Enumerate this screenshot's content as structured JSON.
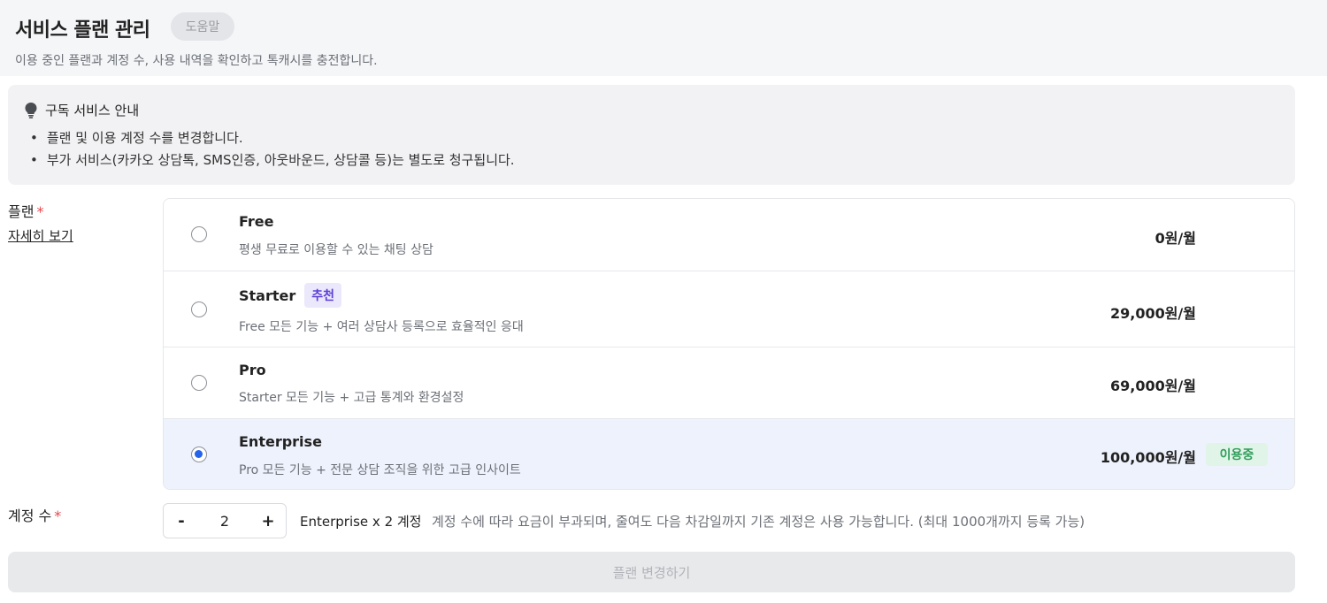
{
  "header": {
    "title": "서비스 플랜 관리",
    "help_label": "도움말",
    "subtitle": "이용 중인 플랜과 계정 수, 사용 내역을 확인하고 톡캐시를 충전합니다."
  },
  "notice": {
    "icon": "lightbulb-icon",
    "title": "구독 서비스 안내",
    "items": [
      "플랜 및 이용 계정 수를 변경합니다.",
      "부가 서비스(카카오 상담톡, SMS인증, 아웃바운드, 상담콜 등)는 별도로 청구됩니다."
    ]
  },
  "plan_section": {
    "label": "플랜",
    "required_mark": "*",
    "detail_link": "자세히 보기",
    "plans": [
      {
        "name": "Free",
        "desc": "평생 무료로 이용할 수 있는 채팅 상담",
        "price": "0원/월",
        "selected": false
      },
      {
        "name": "Starter",
        "badge": "추천",
        "desc": "Free 모든 기능 + 여러 상담사 등록으로 효율적인 응대",
        "price": "29,000원/월",
        "selected": false
      },
      {
        "name": "Pro",
        "desc": "Starter 모든 기능 + 고급 통계와 환경설정",
        "price": "69,000원/월",
        "selected": false
      },
      {
        "name": "Enterprise",
        "desc": "Pro 모든 기능 + 전문 상담 조직을 위한 고급 인사이트",
        "price": "100,000원/월",
        "status": "이용중",
        "selected": true
      }
    ]
  },
  "account_section": {
    "label": "계정 수",
    "required_mark": "*",
    "minus": "-",
    "plus": "+",
    "value": "2",
    "summary": "Enterprise x 2 계정",
    "note": "계정 수에 따라 요금이 부과되며, 줄여도 다음 차감일까지 기존 계정은 사용 가능합니다. (최대 1000개까지 등록 가능)"
  },
  "submit": {
    "label": "플랜 변경하기"
  },
  "colors": {
    "accent": "#2563eb",
    "selected_bg": "#eef2fc",
    "recommend_badge": "#5b3fd6",
    "using_badge": "#2f9e5b",
    "required": "#e5484d"
  }
}
